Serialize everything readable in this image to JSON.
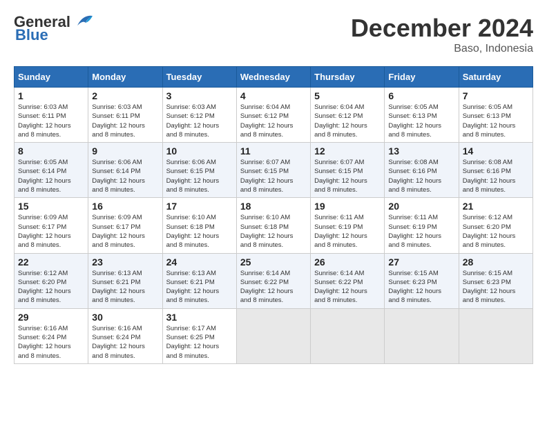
{
  "logo": {
    "line1": "General",
    "line2": "Blue"
  },
  "title": "December 2024",
  "subtitle": "Baso, Indonesia",
  "days_header": [
    "Sunday",
    "Monday",
    "Tuesday",
    "Wednesday",
    "Thursday",
    "Friday",
    "Saturday"
  ],
  "weeks": [
    [
      {
        "day": "1",
        "sunrise": "6:03 AM",
        "sunset": "6:11 PM",
        "daylight": "12 hours and 8 minutes."
      },
      {
        "day": "2",
        "sunrise": "6:03 AM",
        "sunset": "6:11 PM",
        "daylight": "12 hours and 8 minutes."
      },
      {
        "day": "3",
        "sunrise": "6:03 AM",
        "sunset": "6:12 PM",
        "daylight": "12 hours and 8 minutes."
      },
      {
        "day": "4",
        "sunrise": "6:04 AM",
        "sunset": "6:12 PM",
        "daylight": "12 hours and 8 minutes."
      },
      {
        "day": "5",
        "sunrise": "6:04 AM",
        "sunset": "6:12 PM",
        "daylight": "12 hours and 8 minutes."
      },
      {
        "day": "6",
        "sunrise": "6:05 AM",
        "sunset": "6:13 PM",
        "daylight": "12 hours and 8 minutes."
      },
      {
        "day": "7",
        "sunrise": "6:05 AM",
        "sunset": "6:13 PM",
        "daylight": "12 hours and 8 minutes."
      }
    ],
    [
      {
        "day": "8",
        "sunrise": "6:05 AM",
        "sunset": "6:14 PM",
        "daylight": "12 hours and 8 minutes."
      },
      {
        "day": "9",
        "sunrise": "6:06 AM",
        "sunset": "6:14 PM",
        "daylight": "12 hours and 8 minutes."
      },
      {
        "day": "10",
        "sunrise": "6:06 AM",
        "sunset": "6:15 PM",
        "daylight": "12 hours and 8 minutes."
      },
      {
        "day": "11",
        "sunrise": "6:07 AM",
        "sunset": "6:15 PM",
        "daylight": "12 hours and 8 minutes."
      },
      {
        "day": "12",
        "sunrise": "6:07 AM",
        "sunset": "6:15 PM",
        "daylight": "12 hours and 8 minutes."
      },
      {
        "day": "13",
        "sunrise": "6:08 AM",
        "sunset": "6:16 PM",
        "daylight": "12 hours and 8 minutes."
      },
      {
        "day": "14",
        "sunrise": "6:08 AM",
        "sunset": "6:16 PM",
        "daylight": "12 hours and 8 minutes."
      }
    ],
    [
      {
        "day": "15",
        "sunrise": "6:09 AM",
        "sunset": "6:17 PM",
        "daylight": "12 hours and 8 minutes."
      },
      {
        "day": "16",
        "sunrise": "6:09 AM",
        "sunset": "6:17 PM",
        "daylight": "12 hours and 8 minutes."
      },
      {
        "day": "17",
        "sunrise": "6:10 AM",
        "sunset": "6:18 PM",
        "daylight": "12 hours and 8 minutes."
      },
      {
        "day": "18",
        "sunrise": "6:10 AM",
        "sunset": "6:18 PM",
        "daylight": "12 hours and 8 minutes."
      },
      {
        "day": "19",
        "sunrise": "6:11 AM",
        "sunset": "6:19 PM",
        "daylight": "12 hours and 8 minutes."
      },
      {
        "day": "20",
        "sunrise": "6:11 AM",
        "sunset": "6:19 PM",
        "daylight": "12 hours and 8 minutes."
      },
      {
        "day": "21",
        "sunrise": "6:12 AM",
        "sunset": "6:20 PM",
        "daylight": "12 hours and 8 minutes."
      }
    ],
    [
      {
        "day": "22",
        "sunrise": "6:12 AM",
        "sunset": "6:20 PM",
        "daylight": "12 hours and 8 minutes."
      },
      {
        "day": "23",
        "sunrise": "6:13 AM",
        "sunset": "6:21 PM",
        "daylight": "12 hours and 8 minutes."
      },
      {
        "day": "24",
        "sunrise": "6:13 AM",
        "sunset": "6:21 PM",
        "daylight": "12 hours and 8 minutes."
      },
      {
        "day": "25",
        "sunrise": "6:14 AM",
        "sunset": "6:22 PM",
        "daylight": "12 hours and 8 minutes."
      },
      {
        "day": "26",
        "sunrise": "6:14 AM",
        "sunset": "6:22 PM",
        "daylight": "12 hours and 8 minutes."
      },
      {
        "day": "27",
        "sunrise": "6:15 AM",
        "sunset": "6:23 PM",
        "daylight": "12 hours and 8 minutes."
      },
      {
        "day": "28",
        "sunrise": "6:15 AM",
        "sunset": "6:23 PM",
        "daylight": "12 hours and 8 minutes."
      }
    ],
    [
      {
        "day": "29",
        "sunrise": "6:16 AM",
        "sunset": "6:24 PM",
        "daylight": "12 hours and 8 minutes."
      },
      {
        "day": "30",
        "sunrise": "6:16 AM",
        "sunset": "6:24 PM",
        "daylight": "12 hours and 8 minutes."
      },
      {
        "day": "31",
        "sunrise": "6:17 AM",
        "sunset": "6:25 PM",
        "daylight": "12 hours and 8 minutes."
      },
      null,
      null,
      null,
      null
    ]
  ]
}
